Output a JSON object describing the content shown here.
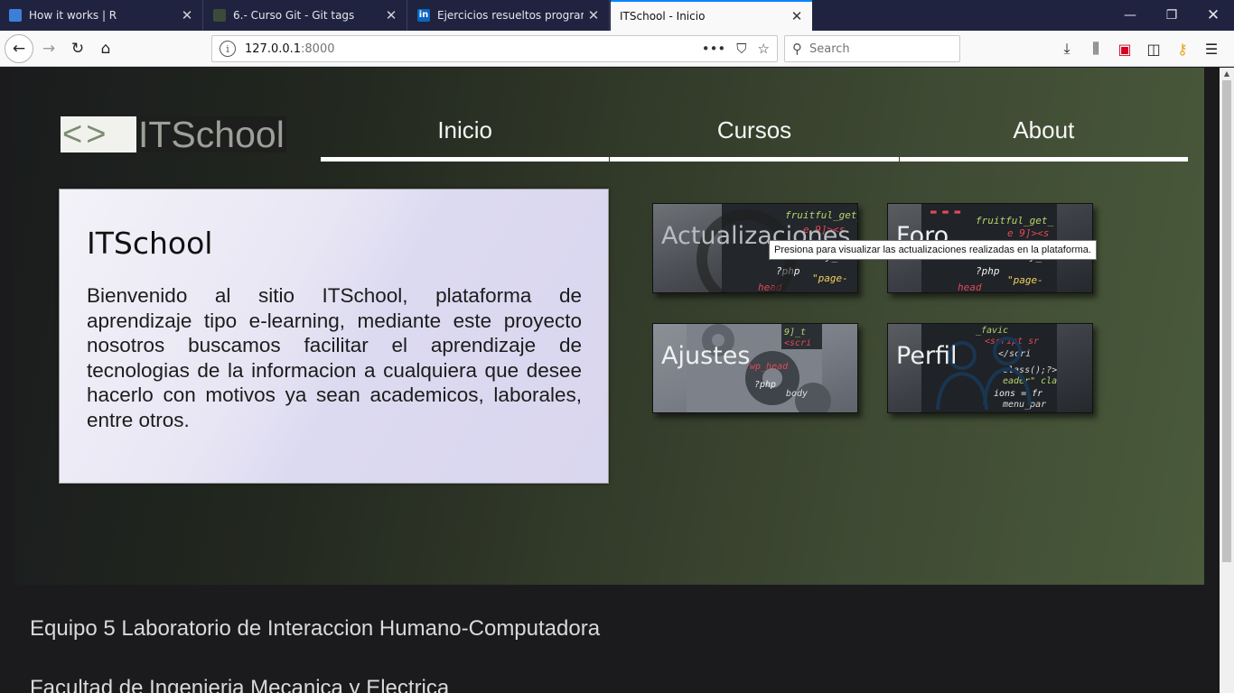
{
  "browser": {
    "tabs": [
      {
        "title": "How it works | R",
        "active": false
      },
      {
        "title": "6.- Curso Git - Git tags",
        "active": false
      },
      {
        "title": "Ejercicios resueltos programaci",
        "active": false
      },
      {
        "title": "ITSchool - Inicio",
        "active": true
      }
    ],
    "url_host": "127.0.0.1",
    "url_port": ":8000",
    "search_placeholder": "Search"
  },
  "page": {
    "logo_brackets": "<>",
    "logo_name": "ITSchool",
    "nav": [
      "Inicio",
      "Cursos",
      "About"
    ],
    "card_title": "ITSchool",
    "card_text": "Bienvenido al sitio ITSchool, plataforma de aprendizaje tipo e-learning, mediante este proyecto nosotros buscamos facilitar el aprendizaje de tecnologias de la informacion a cualquiera que desee hacerlo con motivos ya sean academicos, laborales, entre otros.",
    "tiles": [
      "Actualizaciones",
      "Foro",
      "Ajustes",
      "Perfil"
    ],
    "tooltip": "Presiona para visualizar las actualizaciones realizadas en la plataforma.",
    "footer_line1": "Equipo 5 Laboratorio de Interaccion Humano-Computadora",
    "footer_line2": "Facultad de Ingenieria Mecanica y Electrica"
  }
}
